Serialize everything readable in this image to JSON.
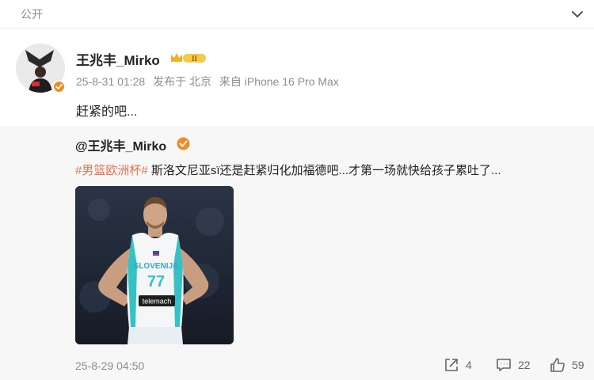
{
  "header": {
    "visibility_label": "公开",
    "chevron_icon": "chevron-down-icon"
  },
  "post": {
    "username": "王兆丰_Mirko",
    "vip_badge_text": "II",
    "timestamp": "25-8-31 01:28",
    "published_from": "发布于 北京",
    "device": "来自 iPhone 16 Pro Max",
    "content": "赶紧的吧..."
  },
  "repost": {
    "username": "@王兆丰_Mirko",
    "hashtag": "#男篮欧洲杯#",
    "text": " 斯洛文尼亚sï还是赶紧归化加福德吧...才第一场就快给孩子累吐了...",
    "image": {
      "jersey_country": "SLOVENIJA",
      "jersey_number": "77",
      "jersey_sponsor": "telemach"
    },
    "timestamp": "25-8-29 04:50",
    "actions": {
      "share_count": "4",
      "comment_count": "22",
      "like_count": "59"
    }
  },
  "colors": {
    "hashtag": "#eb7350",
    "verified_badge": "#f08a24",
    "repost_bg": "#f7f7f7",
    "meta_text": "#8d8d8d"
  }
}
